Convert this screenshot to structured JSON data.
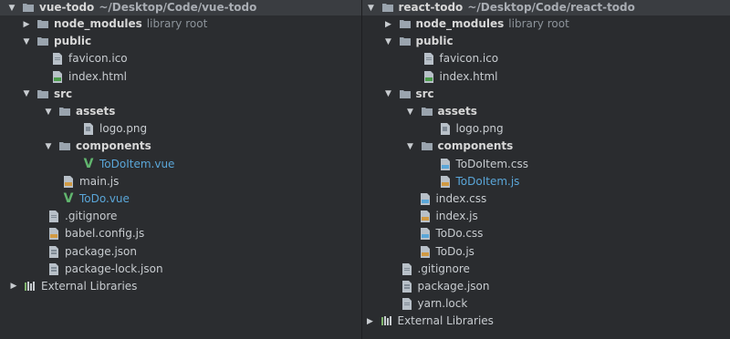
{
  "left_pane": {
    "project_name": "vue-todo",
    "project_path": "~/Desktop/Code/vue-todo",
    "items": [
      {
        "label": "node_modules",
        "extra": "library root"
      },
      {
        "label": "public"
      },
      {
        "label": "favicon.ico"
      },
      {
        "label": "index.html"
      },
      {
        "label": "src"
      },
      {
        "label": "assets"
      },
      {
        "label": "logo.png"
      },
      {
        "label": "components"
      },
      {
        "label": "ToDoItem.vue"
      },
      {
        "label": "main.js"
      },
      {
        "label": "ToDo.vue"
      },
      {
        "label": ".gitignore"
      },
      {
        "label": "babel.config.js"
      },
      {
        "label": "package.json"
      },
      {
        "label": "package-lock.json"
      },
      {
        "label": "External Libraries"
      }
    ]
  },
  "right_pane": {
    "project_name": "react-todo",
    "project_path": "~/Desktop/Code/react-todo",
    "items": [
      {
        "label": "node_modules",
        "extra": "library root"
      },
      {
        "label": "public"
      },
      {
        "label": "favicon.ico"
      },
      {
        "label": "index.html"
      },
      {
        "label": "src"
      },
      {
        "label": "assets"
      },
      {
        "label": "logo.png"
      },
      {
        "label": "components"
      },
      {
        "label": "ToDoItem.css"
      },
      {
        "label": "ToDoItem.js"
      },
      {
        "label": "index.css"
      },
      {
        "label": "index.js"
      },
      {
        "label": "ToDo.css"
      },
      {
        "label": "ToDo.js"
      },
      {
        "label": ".gitignore"
      },
      {
        "label": "package.json"
      },
      {
        "label": "yarn.lock"
      },
      {
        "label": "External Libraries"
      }
    ]
  },
  "icons": {
    "folder": "folder-icon",
    "file": "file-icon",
    "vue": "vue-file-icon",
    "library": "external-libraries-icon"
  },
  "colors": {
    "background": "#2b2d30",
    "header": "#3a3d41",
    "text": "#c8ccd0",
    "muted": "#8d949b",
    "blue": "#5aa6d8",
    "green": "#61b56e"
  }
}
